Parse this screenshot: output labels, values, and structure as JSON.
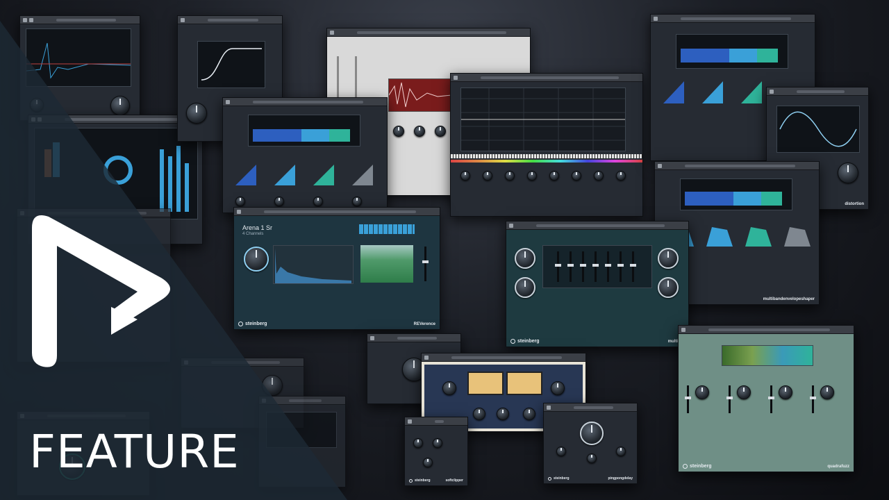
{
  "overlay": {
    "label": "FEATURE",
    "tint_color": "#1d2a34",
    "logo_color": "#ffffff"
  },
  "plugins": {
    "reverence": {
      "preset": "Arena 1 Sr",
      "channels": "4 Channels",
      "brand": "steinberg",
      "name": "REVerence"
    },
    "multitap": {
      "brand": "steinberg",
      "name": "multitap"
    },
    "multiband_envelope": {
      "name": "multibandenvelopeshaper"
    },
    "quadrafuzz": {
      "brand": "steinberg",
      "name": "quadrafuzz"
    },
    "softclipper": {
      "brand": "steinberg",
      "name": "softclipper"
    },
    "pingpong": {
      "brand": "steinberg",
      "name": "pingpongdelay"
    },
    "distortion": {
      "name": "distortion"
    },
    "frequency": {
      "brand": "steinberg"
    },
    "other": {
      "brand": "steinberg"
    }
  },
  "colors": {
    "accent_blue": "#3aa0d8",
    "accent_teal": "#2fb39a"
  }
}
